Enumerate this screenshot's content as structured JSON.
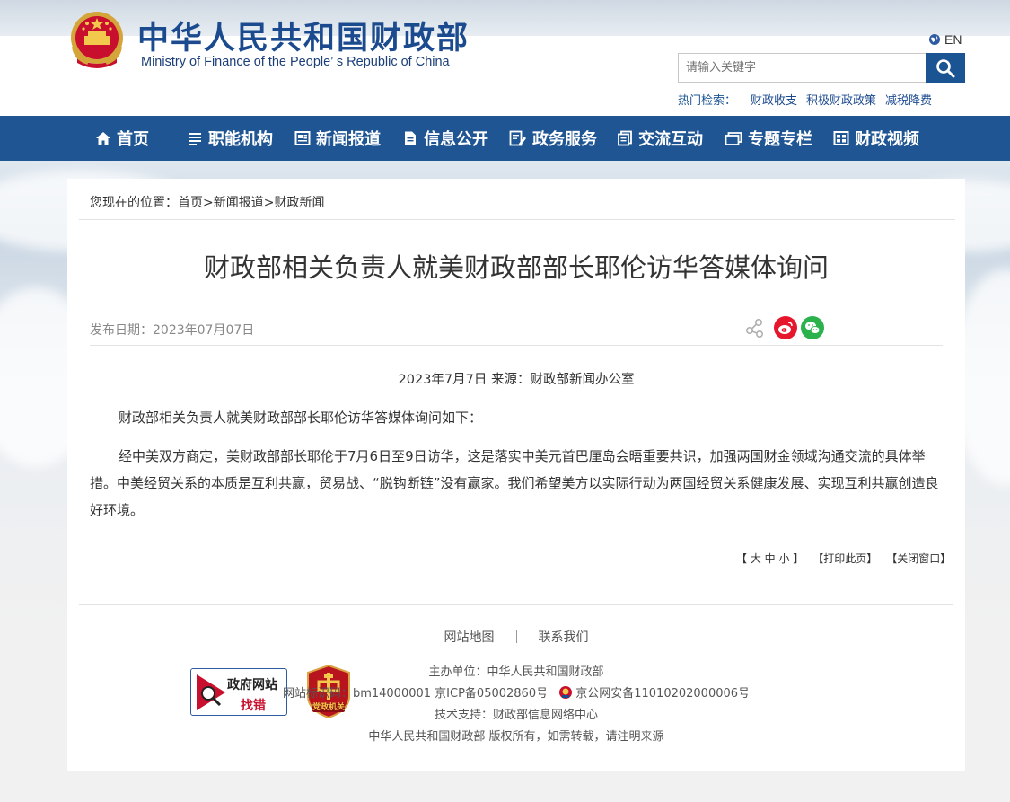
{
  "header": {
    "title_cn": "中华人民共和国财政部",
    "title_en": "Ministry of Finance of the People’ s Republic of China",
    "lang_label": "EN",
    "search_placeholder": "请输入关键字",
    "hot_label": "热门检索：",
    "hot_items": [
      "财政收支",
      "积极财政政策",
      "减税降费"
    ]
  },
  "nav": {
    "items": [
      {
        "label": "首页",
        "icon": "home-icon"
      },
      {
        "label": "职能机构",
        "icon": "list-icon"
      },
      {
        "label": "新闻报道",
        "icon": "newspaper-icon"
      },
      {
        "label": "信息公开",
        "icon": "document-icon"
      },
      {
        "label": "政务服务",
        "icon": "edit-document-icon"
      },
      {
        "label": "交流互动",
        "icon": "copy-icon"
      },
      {
        "label": "专题专栏",
        "icon": "folder-icon"
      },
      {
        "label": "财政视频",
        "icon": "video-icon"
      }
    ]
  },
  "breadcrumb": {
    "prefix": "您现在的位置：",
    "items": [
      "首页",
      "新闻报道",
      "财政新闻"
    ],
    "sep": ">"
  },
  "article": {
    "title": "财政部相关负责人就美财政部部长耶伦访华答媒体询问",
    "pubdate": "发布日期：2023年07月07日",
    "source": "2023年7月7日  来源：财政部新闻办公室",
    "para1": "财政部相关负责人就美财政部部长耶伦访华答媒体询问如下：",
    "para2": "经中美双方商定，美财政部部长耶伦于7月6日至9日访华，这是落实中美元首巴厘岛会晤重要共识，加强两国财金领域沟通交流的具体举措。中美经贸关系的本质是互利共赢，贸易战、“脱钩断链”没有赢家。我们希望美方以实际行动为两国经贸关系健康发展、实现互利共赢创造良好环境。"
  },
  "tools": {
    "font_size": "【 大 中 小 】",
    "print": "【打印此页】",
    "close": "【关闭窗口】"
  },
  "footer": {
    "sitemap": "网站地图",
    "contact": "联系我们",
    "sponsor": "主办单位：中华人民共和国财政部",
    "site_id": "网站标识码：bm14000001  京ICP备05002860号",
    "police": "京公网安备11010202000006号",
    "tech": "技术支持：财政部信息网络中心",
    "copyright": "中华人民共和国财政部  版权所有，如需转载，请注明来源",
    "badge_gov_top": "政府网站",
    "badge_gov_bottom": "找错",
    "badge_party": "党政机关"
  },
  "colors": {
    "nav_bg": "#1f5592",
    "brand_blue": "#1b4a8f",
    "weibo": "#e6162d",
    "wechat": "#2bb24c"
  }
}
